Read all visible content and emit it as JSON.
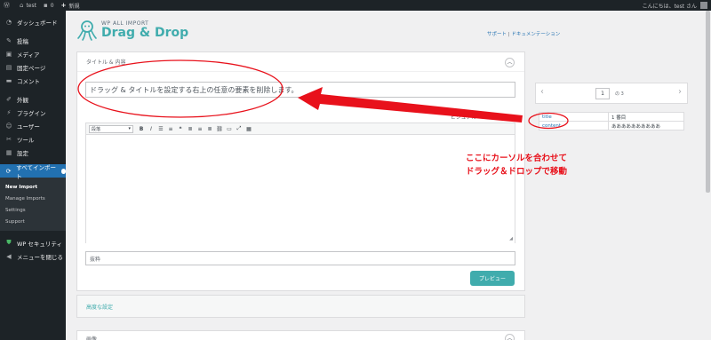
{
  "adminbar": {
    "site_name": "test",
    "comments_count": "0",
    "new_label": "新規",
    "greeting": "こんにちは、test さん"
  },
  "sidebar": {
    "items": [
      {
        "label": "ダッシュボード",
        "icon": "dashboard-icon"
      },
      {
        "label": "投稿",
        "icon": "pin-icon"
      },
      {
        "label": "メディア",
        "icon": "media-icon"
      },
      {
        "label": "固定ページ",
        "icon": "page-icon"
      },
      {
        "label": "コメント",
        "icon": "comment-icon"
      },
      {
        "label": "外観",
        "icon": "brush-icon"
      },
      {
        "label": "プラグイン",
        "icon": "plugin-icon"
      },
      {
        "label": "ユーザー",
        "icon": "user-icon"
      },
      {
        "label": "ツール",
        "icon": "wrench-icon"
      },
      {
        "label": "設定",
        "icon": "settings-icon"
      },
      {
        "label": "すべてインポート",
        "icon": "import-icon"
      },
      {
        "label": "WP セキュリティ",
        "icon": "shield-icon"
      },
      {
        "label": "メニューを閉じる",
        "icon": "collapse-icon"
      }
    ],
    "submenu": [
      "New Import",
      "Manage Imports",
      "Settings",
      "Support"
    ]
  },
  "header": {
    "logo_small": "WP ALL IMPORT",
    "logo_big": "Drag & Drop",
    "link_support": "サポート",
    "link_sep": "|",
    "link_docs": "ドキュメンテーション"
  },
  "main": {
    "section_title": "タイトル & 内容",
    "title_value": "ドラッグ & タイトルを設定する右上の任意の要素を削除します。",
    "tab_visual": "ビジュアル",
    "tab_text": "テキスト",
    "format_select": "段落",
    "slug_placeholder": "抜粋",
    "preview_label": "プレビュー",
    "advanced_label": "高度な設定",
    "section3_label": "画像"
  },
  "data_panel": {
    "page_number": "1",
    "page_of": "の 3",
    "rows": [
      {
        "key": "title",
        "value": "1 番目"
      },
      {
        "key": "content",
        "value": "ああああああああああ"
      }
    ]
  },
  "annotation": {
    "line1": "ここにカーソルを合わせて",
    "line2": "ドラッグ＆ドロップで移動",
    "color": "#e8111b"
  },
  "colors": {
    "accent": "#40acad",
    "sidebar_bg": "#1d2327",
    "active_menu": "#2271b1"
  }
}
